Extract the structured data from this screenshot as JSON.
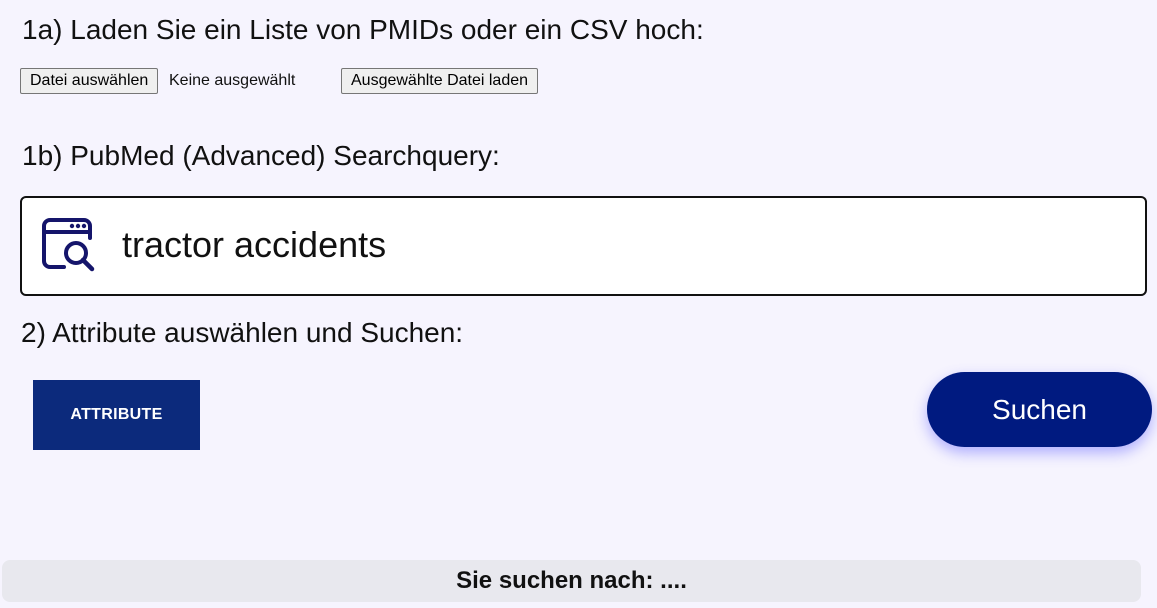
{
  "section_1a": {
    "heading": "1a) Laden Sie ein Liste von PMIDs oder ein CSV hoch:",
    "choose_file_label": "Datei auswählen",
    "file_status": "Keine ausgewählt",
    "load_file_label": "Ausgewählte Datei laden"
  },
  "section_1b": {
    "heading": "1b) PubMed (Advanced) Searchquery:",
    "query_value": "tractor accidents",
    "icon": "browser-search-icon"
  },
  "section_2": {
    "heading": "2) Attribute auswählen und Suchen:",
    "attribute_button": "ATTRIBUTE",
    "search_button": "Suchen"
  },
  "status": {
    "text": "Sie suchen nach: ...."
  },
  "colors": {
    "page_background": "#f6f4fe",
    "primary": "#001a80",
    "attribute_button": "#0c2a7c",
    "status_bar": "#e8e8ee"
  }
}
